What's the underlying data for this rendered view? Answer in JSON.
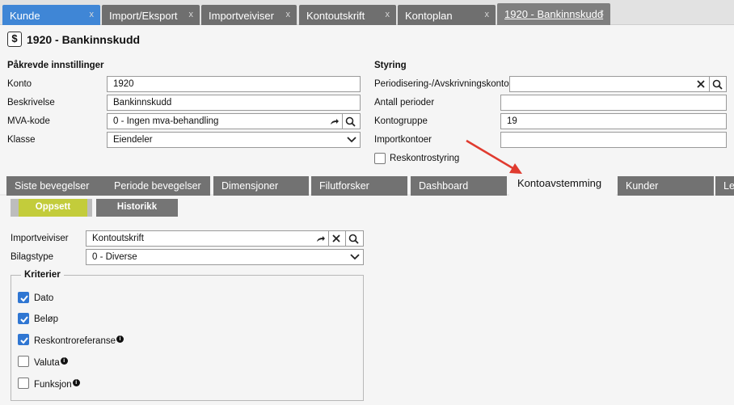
{
  "window_tabs": [
    {
      "label": "Kunde",
      "close": "x"
    },
    {
      "label": "Import/Eksport",
      "close": "x"
    },
    {
      "label": "Importveiviser",
      "close": "x"
    },
    {
      "label": "Kontoutskrift",
      "close": "x"
    },
    {
      "label": "Kontoplan",
      "close": "x"
    },
    {
      "label": "1920 - Bankinnskudd",
      "close": "x"
    }
  ],
  "header": {
    "icon_char": "$",
    "title": "1920 - Bankinnskudd"
  },
  "required": {
    "title": "Påkrevde innstillinger",
    "konto_label": "Konto",
    "konto_value": "1920",
    "beskrivelse_label": "Beskrivelse",
    "beskrivelse_value": "Bankinnskudd",
    "mva_label": "MVA-kode",
    "mva_value": "0 - Ingen mva-behandling",
    "klasse_label": "Klasse",
    "klasse_value": "Eiendeler"
  },
  "styring": {
    "title": "Styring",
    "periodisering_label": "Periodisering-/Avskrivningskonto",
    "periodisering_value": "",
    "antall_label": "Antall perioder",
    "antall_value": "",
    "kontogruppe_label": "Kontogruppe",
    "kontogruppe_value": "19",
    "importkontoer_label": "Importkontoer",
    "importkontoer_value": "",
    "reskontro_label": "Reskontrostyring",
    "reskontro_checked": false
  },
  "section_tabs": [
    {
      "label": "Siste bevegelser"
    },
    {
      "label": "Periode bevegelser"
    },
    {
      "label": "Dimensjoner"
    },
    {
      "label": "Filutforsker"
    },
    {
      "label": "Dashboard"
    },
    {
      "label": "Kontoavstemming",
      "active": true
    },
    {
      "label": "Kunder"
    },
    {
      "label": "Le"
    }
  ],
  "subtabs": {
    "oppsett": "Oppsett",
    "historikk": "Historikk"
  },
  "kontoavstemming": {
    "importveiviser_label": "Importveiviser",
    "importveiviser_value": "Kontoutskrift",
    "bilagstype_label": "Bilagstype",
    "bilagstype_value": "0 - Diverse",
    "kriterier_title": "Kriterier",
    "criteria": [
      {
        "label": "Dato",
        "checked": true,
        "info": false
      },
      {
        "label": "Beløp",
        "checked": true,
        "info": false
      },
      {
        "label": "Reskontroreferanse",
        "checked": true,
        "info": true
      },
      {
        "label": "Valuta",
        "checked": false,
        "info": true
      },
      {
        "label": "Funksjon",
        "checked": false,
        "info": true
      }
    ]
  },
  "colors": {
    "accent_blue": "#3f86d6",
    "tab_gray": "#727272",
    "oppsett_green": "#c3cc3b",
    "annotation_red": "#e03b2f"
  }
}
